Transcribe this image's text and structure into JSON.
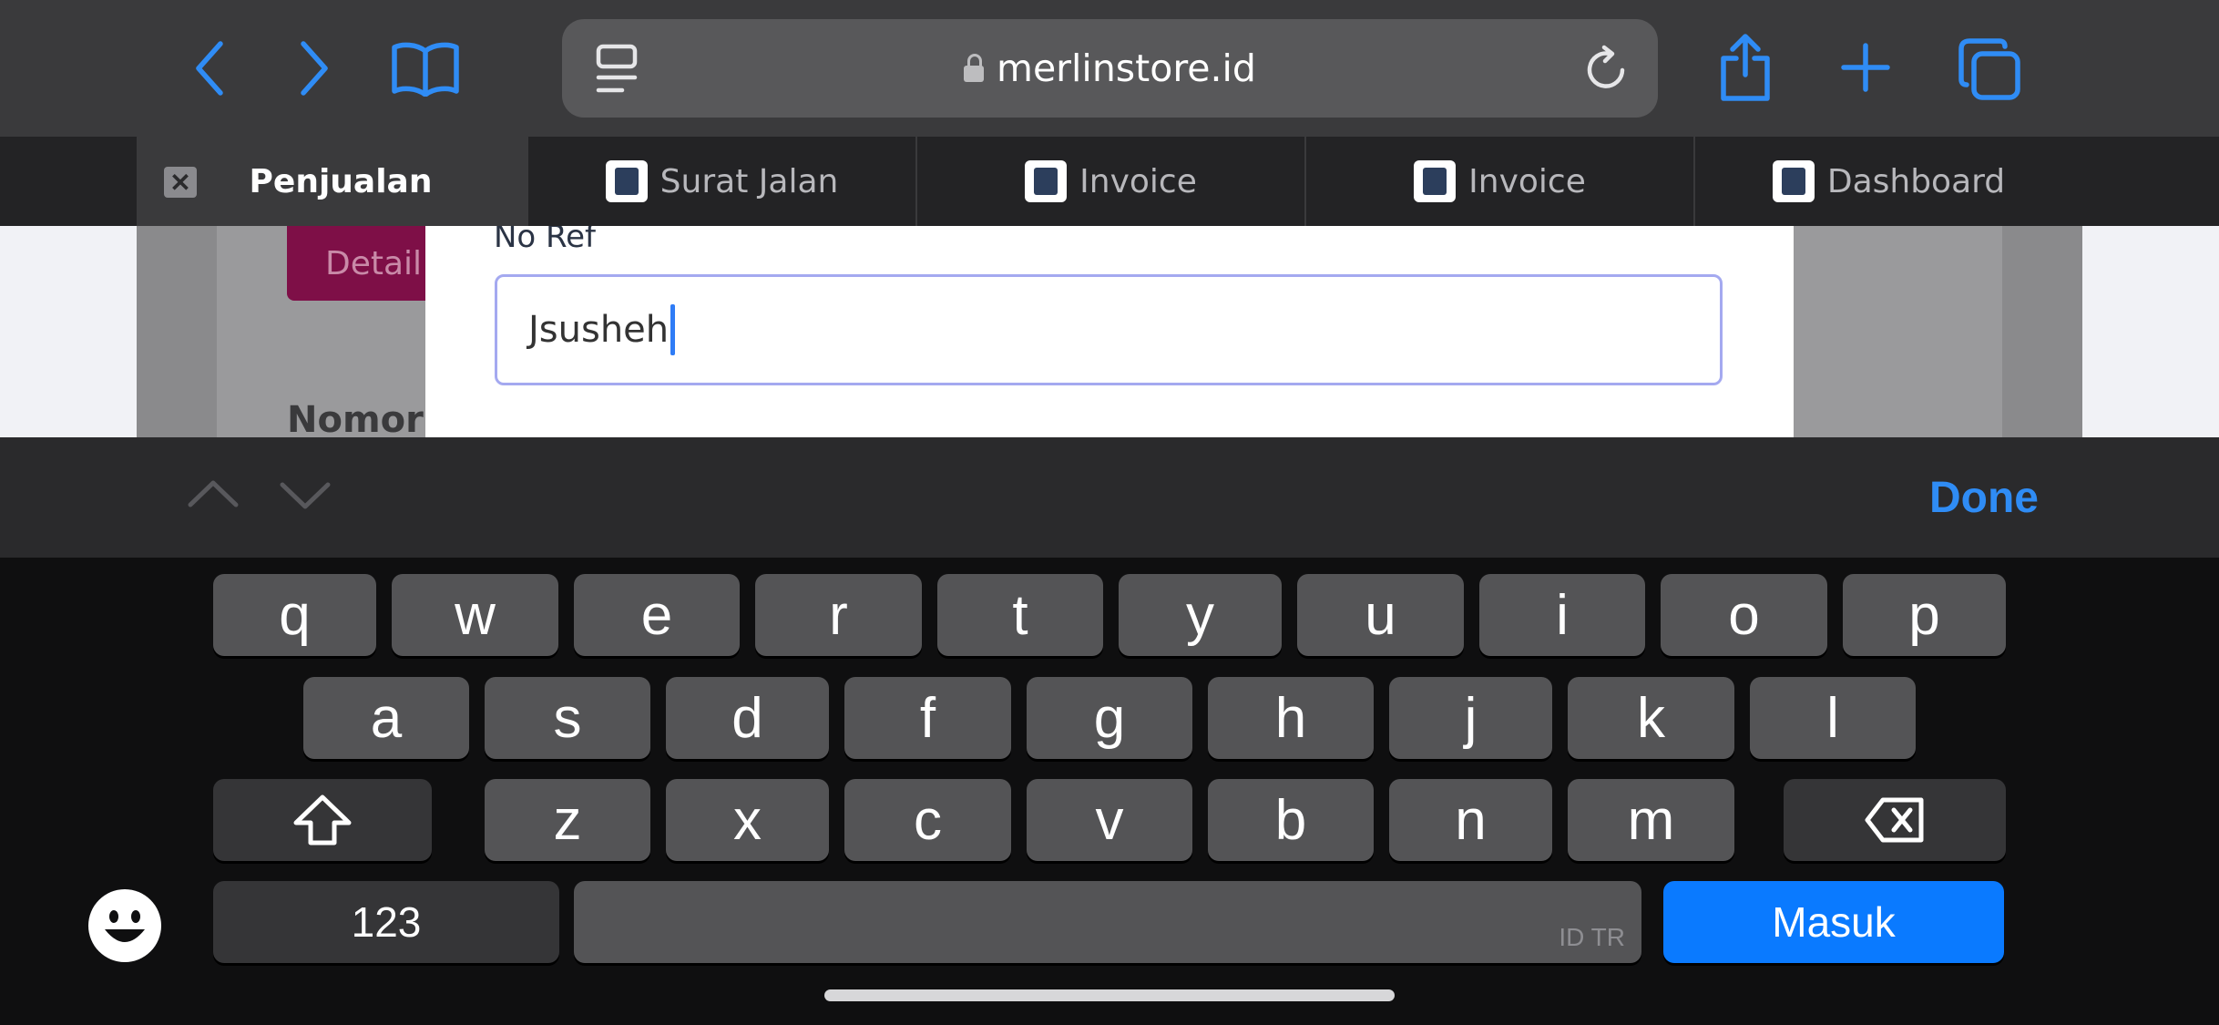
{
  "browser": {
    "url": "merlinstore.id",
    "icons": {
      "back": "chevron-left-icon",
      "forward": "chevron-right-icon",
      "bookmarks": "book-icon",
      "reader": "reader-icon",
      "reload": "reload-icon",
      "share": "share-icon",
      "new_tab": "plus-icon",
      "tabs": "tabs-icon",
      "lock": "lock-icon"
    }
  },
  "tabs": [
    {
      "label": "Penjualan",
      "active": true
    },
    {
      "label": "Surat Jalan",
      "active": false
    },
    {
      "label": "Invoice",
      "active": false
    },
    {
      "label": "Invoice",
      "active": false
    },
    {
      "label": "Dashboard",
      "active": false
    }
  ],
  "page": {
    "detail_button": "Detail",
    "nomor_label": "Nomor",
    "field_label": "No Ref",
    "field_value": "Jsusheh"
  },
  "accessory_bar": {
    "done_label": "Done"
  },
  "keyboard": {
    "row1": [
      "q",
      "w",
      "e",
      "r",
      "t",
      "y",
      "u",
      "i",
      "o",
      "p"
    ],
    "row2": [
      "a",
      "s",
      "d",
      "f",
      "g",
      "h",
      "j",
      "k",
      "l"
    ],
    "row3": [
      "z",
      "x",
      "c",
      "v",
      "b",
      "n",
      "m"
    ],
    "numbers_label": "123",
    "enter_label": "Masuk",
    "space_hint": "ID TR"
  },
  "colors": {
    "accent": "#2f8cf5",
    "enter_key": "#0a7aff",
    "detail_button": "#7e0f47",
    "input_border": "#a4a9f0"
  }
}
